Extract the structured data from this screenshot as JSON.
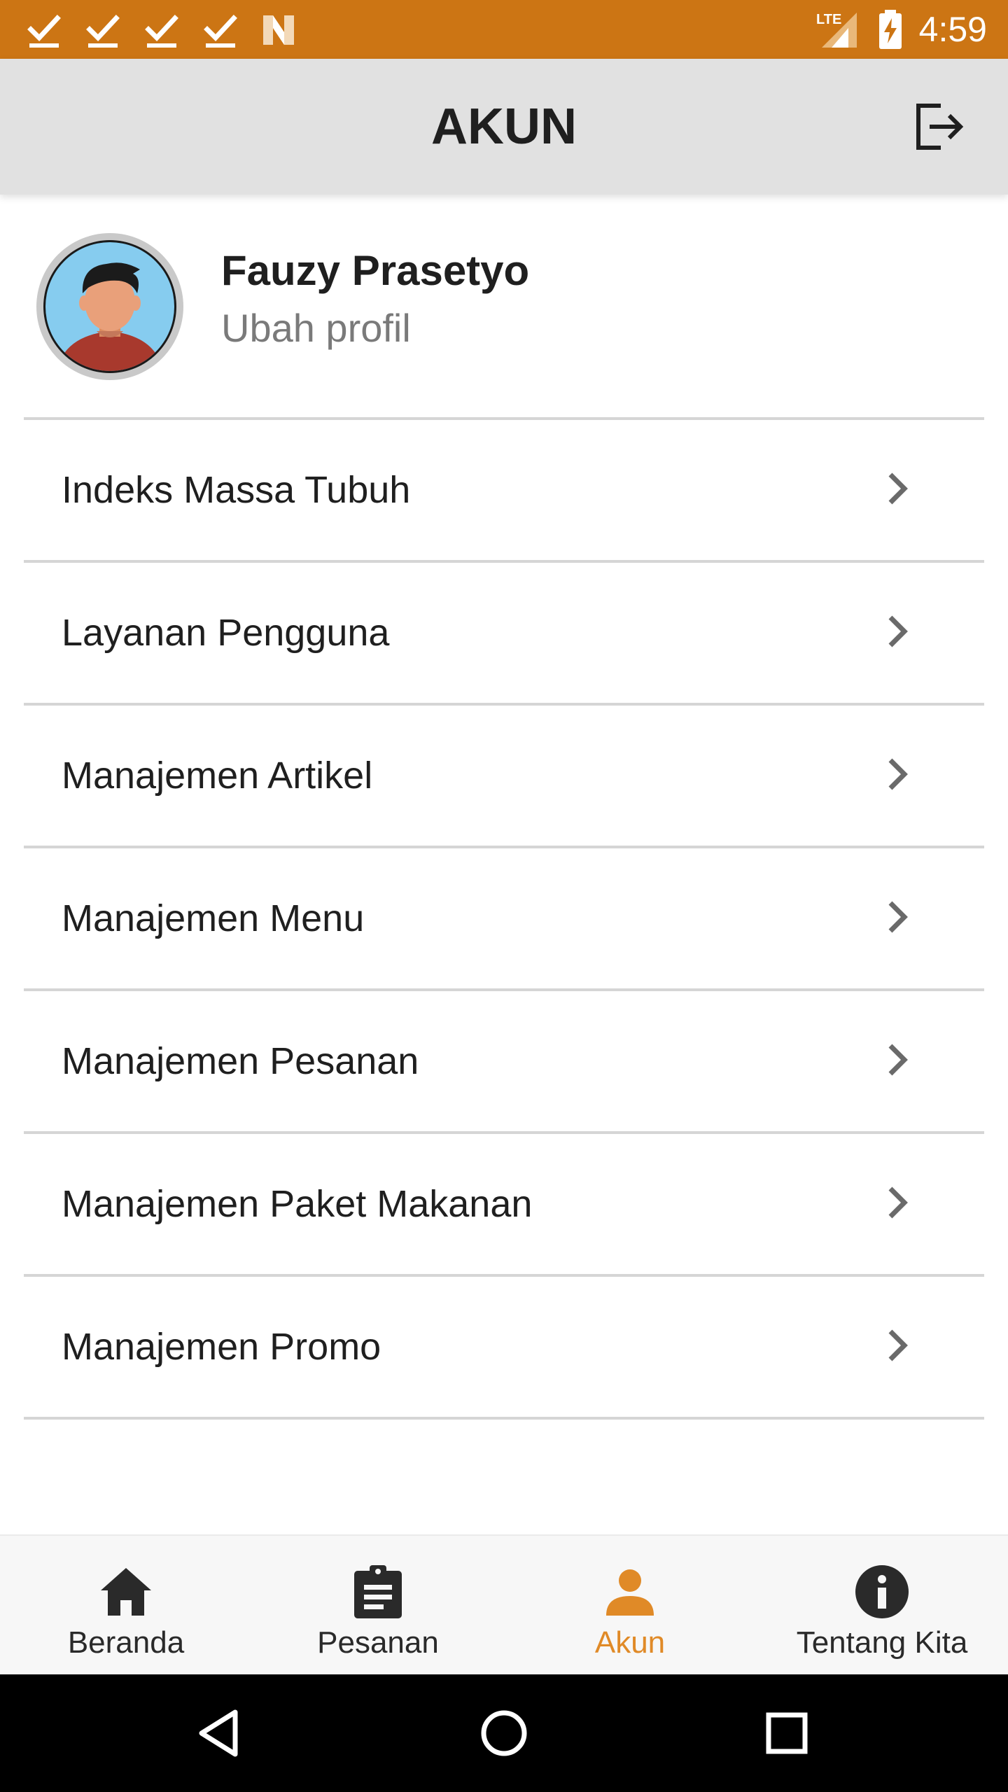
{
  "status_bar": {
    "time": "4:59",
    "background_color": "#cc7514",
    "left_icons": [
      "check-icon",
      "check-icon",
      "check-icon",
      "check-icon",
      "n-app-icon"
    ],
    "right_icons": [
      "lte-signal-icon",
      "battery-charging-icon"
    ],
    "network_label": "LTE"
  },
  "app_bar": {
    "title": "AKUN",
    "action_icon": "logout-icon"
  },
  "profile": {
    "name": "Fauzy Prasetyo",
    "subtitle": "Ubah profil",
    "avatar_icon": "user-avatar-icon"
  },
  "menu": {
    "items": [
      {
        "label": "Indeks Massa Tubuh"
      },
      {
        "label": "Layanan Pengguna"
      },
      {
        "label": "Manajemen Artikel"
      },
      {
        "label": "Manajemen Menu"
      },
      {
        "label": "Manajemen Pesanan"
      },
      {
        "label": "Manajemen Paket Makanan"
      },
      {
        "label": "Manajemen Promo"
      }
    ],
    "item_icon": "chevron-right-icon"
  },
  "bottom_nav": {
    "items": [
      {
        "label": "Beranda",
        "icon": "home-icon",
        "active": false
      },
      {
        "label": "Pesanan",
        "icon": "clipboard-icon",
        "active": false
      },
      {
        "label": "Akun",
        "icon": "person-icon",
        "active": true
      },
      {
        "label": "Tentang Kita",
        "icon": "info-icon",
        "active": false
      }
    ],
    "active_color": "#e08a27",
    "inactive_color": "#2a2a2a"
  },
  "system_nav": {
    "buttons": [
      "back-icon",
      "home-circle-icon",
      "recents-icon"
    ]
  }
}
